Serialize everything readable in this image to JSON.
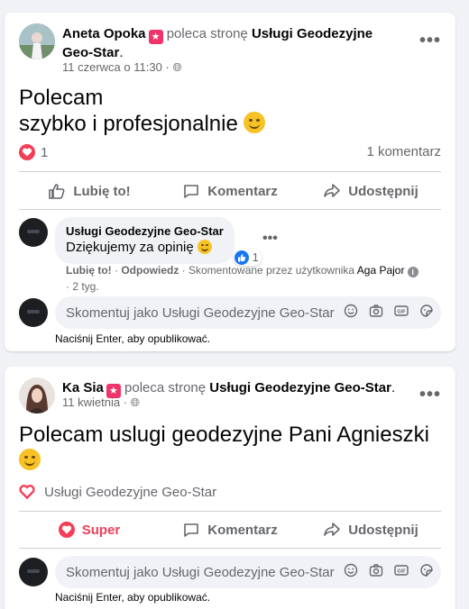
{
  "posts": [
    {
      "author": "Aneta Opoka",
      "verb": "poleca stronę",
      "page_name": "Usługi Geodezyjne Geo-Star",
      "timestamp": "11 czerwca o 11:30",
      "text_line1": "Polecam",
      "text_line2": "szybko i profesjonalnie",
      "reaction_count": "1",
      "comment_count": "1 komentarz",
      "actions": {
        "like": "Lubię to!",
        "comment": "Komentarz",
        "share": "Udostępnij"
      },
      "comment": {
        "author": "Usługi Geodezyjne Geo-Star",
        "text": "Dziękujemy za opinię",
        "like_count": "1",
        "like_link": "Lubię to!",
        "reply_link": "Odpowiedz",
        "commented_by": "Skomentowane przez użytkownika",
        "commented_by_name": "Aga Pajor",
        "age": "2 tyg."
      },
      "input_placeholder": "Skomentuj jako Usługi Geodezyjne Geo-Star",
      "enter_hint": "Naciśnij Enter, aby opublikować."
    },
    {
      "author": "Ka Sia",
      "verb": "poleca stronę",
      "page_name": "Usługi Geodezyjne Geo-Star",
      "timestamp": "11 kwietnia",
      "text_line1": "Polecam uslugi geodezyjne Pani Agnieszki",
      "page_tag": "Usługi Geodezyjne Geo-Star",
      "actions": {
        "super": "Super",
        "comment": "Komentarz",
        "share": "Udostępnij"
      },
      "input_placeholder": "Skomentuj jako Usługi Geodezyjne Geo-Star",
      "enter_hint": "Naciśnij Enter, aby opublikować."
    }
  ],
  "colors": {
    "heart": "#f33e58",
    "like_blue": "#1877f2",
    "recommend_star": "#f0346a"
  }
}
